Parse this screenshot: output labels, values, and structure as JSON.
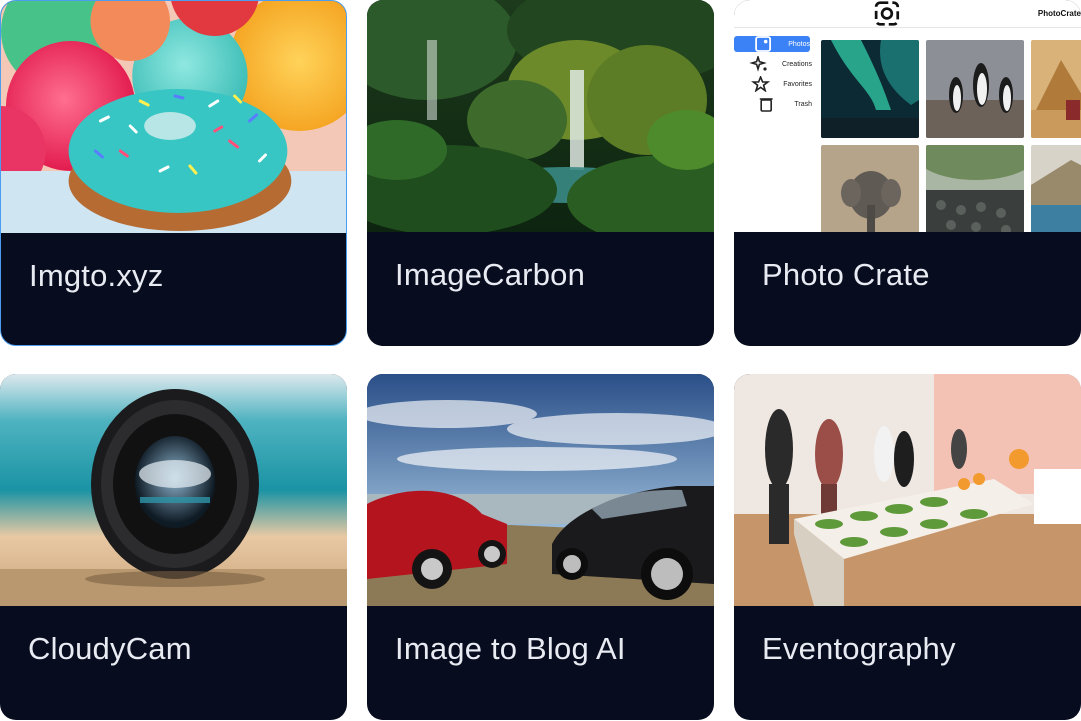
{
  "cards": [
    {
      "title": "Imgto.xyz",
      "image": "donut-with-sprinkles"
    },
    {
      "title": "ImageCarbon",
      "image": "jungle-waterfall"
    },
    {
      "title": "Photo Crate",
      "image": "photocrate-app-screenshot"
    },
    {
      "title": "CloudyCam",
      "image": "camera-lens-on-beach"
    },
    {
      "title": "Image to Blog AI",
      "image": "sports-cars-at-overlook"
    },
    {
      "title": "Eventography",
      "image": "catered-event-room"
    }
  ],
  "photocrate": {
    "app_name": "PhotoCrate",
    "nav": [
      {
        "label": "Photos",
        "icon": "image-icon"
      },
      {
        "label": "Creations",
        "icon": "sparkle-icon"
      },
      {
        "label": "Favorites",
        "icon": "star-icon"
      },
      {
        "label": "Trash",
        "icon": "trash-icon"
      }
    ],
    "active_nav": "Photos",
    "photos": [
      "aurora",
      "penguins",
      "desert-pyramid-camel",
      "elephant",
      "basalt-coast",
      "coastal-town"
    ]
  },
  "colors": {
    "card_footer": "#070c1f",
    "card_text": "#e9ebf2",
    "selected_border": "#4a9df0",
    "nav_active": "#3b82f6"
  }
}
